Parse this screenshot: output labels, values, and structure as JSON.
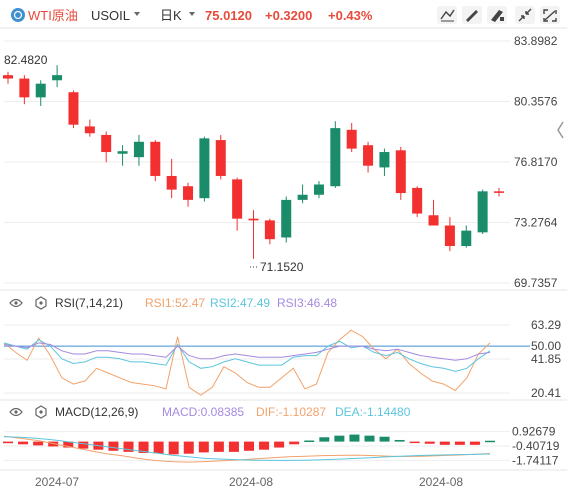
{
  "header": {
    "instrument_name": "WTI原油",
    "symbol": "USOIL",
    "period": "日K",
    "last_price": "75.0120",
    "change": "+0.3200",
    "change_pct": "+0.43%",
    "icons": [
      "instrument-logo-icon",
      "dropdown-caret-icon",
      "dropdown-caret-icon",
      "chart-style-icon",
      "draw-line-icon",
      "drawing-tools-icon",
      "shrink-icon",
      "fullscreen-icon"
    ]
  },
  "colors": {
    "up": "#f23030",
    "down": "#1a8c6a",
    "accent": "#e84a3b",
    "rsi1": "#f2a26b",
    "rsi2": "#5bc6de",
    "rsi3": "#a58ae0",
    "macd_label": "#a58ae0",
    "dif": "#f2a26b",
    "dea": "#5bc6de",
    "midline": "#3f8fd2",
    "grid": "#eeeeee",
    "text": "#333333",
    "axis_text": "#444444"
  },
  "price_axis_labels": [
    "83.8982",
    "80.3576",
    "76.8170",
    "73.2764",
    "69.7357"
  ],
  "rsi_axis_labels": [
    "63.29",
    "50.00",
    "41.85",
    "20.41"
  ],
  "macd_axis_labels": [
    "0.92679",
    "-0.40719",
    "-1.74117"
  ],
  "x_axis_labels": [
    "2024-07",
    "2024-08",
    "2024-08"
  ],
  "rsi_panel": {
    "name": "RSI(7,14,21)",
    "rsi1_label": "RSI1:52.47",
    "rsi2_label": "RSI2:47.49",
    "rsi3_label": "RSI3:46.48"
  },
  "macd_panel": {
    "name": "MACD(12,26,9)",
    "macd_label": "MACD:0.08385",
    "dif_label": "DIF:-1.10287",
    "dea_label": "DEA:-1.14480"
  },
  "chart_data": [
    {
      "type": "candlestick",
      "title": "WTI原油 USOIL 日K",
      "y_axis_ticks": [
        83.8982,
        80.3576,
        76.817,
        73.2764,
        69.7357
      ],
      "ylim": [
        69.7357,
        83.8982
      ],
      "x_tick_labels": [
        "2024-07",
        "2024-08",
        "2024-08"
      ],
      "annotations": [
        {
          "text": "82.4820",
          "value": 82.482,
          "kind": "highest visible high"
        },
        {
          "text": "71.1520",
          "value": 71.152,
          "kind": "lowest visible low"
        }
      ],
      "candles": [
        {
          "open": 81.9,
          "high": 82.1,
          "low": 81.4,
          "close": 81.7
        },
        {
          "open": 81.7,
          "high": 81.9,
          "low": 80.2,
          "close": 80.6
        },
        {
          "open": 80.6,
          "high": 81.6,
          "low": 80.1,
          "close": 81.4
        },
        {
          "open": 81.6,
          "high": 82.48,
          "low": 81.2,
          "close": 81.9
        },
        {
          "open": 80.9,
          "high": 81.0,
          "low": 78.8,
          "close": 79.0
        },
        {
          "open": 78.9,
          "high": 79.3,
          "low": 78.3,
          "close": 78.5
        },
        {
          "open": 78.4,
          "high": 78.6,
          "low": 76.8,
          "close": 77.4
        },
        {
          "open": 77.3,
          "high": 77.8,
          "low": 76.6,
          "close": 77.45
        },
        {
          "open": 77.1,
          "high": 78.4,
          "low": 76.6,
          "close": 78.0
        },
        {
          "open": 78.0,
          "high": 78.1,
          "low": 75.7,
          "close": 76.0
        },
        {
          "open": 76.0,
          "high": 77.0,
          "low": 74.7,
          "close": 75.2
        },
        {
          "open": 75.4,
          "high": 75.6,
          "low": 74.2,
          "close": 74.6
        },
        {
          "open": 74.7,
          "high": 78.3,
          "low": 74.5,
          "close": 78.2
        },
        {
          "open": 78.1,
          "high": 78.4,
          "low": 75.8,
          "close": 76.0
        },
        {
          "open": 75.8,
          "high": 75.9,
          "low": 72.8,
          "close": 73.5
        },
        {
          "open": 73.5,
          "high": 74.0,
          "low": 71.15,
          "close": 73.4
        },
        {
          "open": 73.4,
          "high": 73.5,
          "low": 72.0,
          "close": 72.3
        },
        {
          "open": 72.4,
          "high": 74.8,
          "low": 72.1,
          "close": 74.6
        },
        {
          "open": 74.6,
          "high": 75.5,
          "low": 74.4,
          "close": 74.9
        },
        {
          "open": 74.9,
          "high": 75.7,
          "low": 74.7,
          "close": 75.5
        },
        {
          "open": 75.4,
          "high": 79.2,
          "low": 75.3,
          "close": 78.8
        },
        {
          "open": 78.7,
          "high": 79.1,
          "low": 77.4,
          "close": 77.6
        },
        {
          "open": 77.8,
          "high": 78.0,
          "low": 76.2,
          "close": 76.6
        },
        {
          "open": 76.5,
          "high": 77.6,
          "low": 76.0,
          "close": 77.4
        },
        {
          "open": 77.5,
          "high": 77.7,
          "low": 74.6,
          "close": 75.0
        },
        {
          "open": 75.3,
          "high": 75.4,
          "low": 73.6,
          "close": 73.8
        },
        {
          "open": 73.7,
          "high": 74.6,
          "low": 73.1,
          "close": 73.1
        },
        {
          "open": 73.1,
          "high": 73.6,
          "low": 71.6,
          "close": 71.9
        },
        {
          "open": 71.9,
          "high": 73.1,
          "low": 71.8,
          "close": 72.8
        },
        {
          "open": 72.7,
          "high": 75.2,
          "low": 72.6,
          "close": 75.1
        },
        {
          "open": 75.1,
          "high": 75.3,
          "low": 74.8,
          "close": 75.01
        }
      ]
    },
    {
      "type": "line",
      "title": "RSI(7,14,21)",
      "y_axis_ticks": [
        63.29,
        50.0,
        41.85,
        20.41
      ],
      "ylim": [
        20.41,
        63.29
      ],
      "reference_line": 50.0,
      "series": [
        {
          "name": "RSI1",
          "values": [
            52,
            46,
            41,
            55,
            44,
            30,
            26,
            28,
            36,
            33,
            30,
            27,
            26,
            25,
            23,
            56,
            24,
            19,
            24,
            37,
            33,
            27,
            24,
            24,
            30,
            36,
            23,
            26,
            46,
            54,
            60,
            56,
            48,
            42,
            48,
            39,
            33,
            28,
            26,
            22,
            30,
            45,
            52
          ]
        },
        {
          "name": "RSI2",
          "values": [
            52,
            50,
            48,
            54,
            50,
            42,
            39,
            40,
            43,
            43,
            42,
            40,
            40,
            39,
            38,
            51,
            40,
            36,
            37,
            40,
            42,
            40,
            38,
            38,
            38,
            43,
            44,
            44,
            50,
            53,
            49,
            50,
            46,
            44,
            46,
            42,
            39,
            37,
            36,
            34,
            36,
            42,
            47
          ]
        },
        {
          "name": "RSI3",
          "values": [
            51,
            50,
            49,
            52,
            51,
            47,
            45,
            45,
            47,
            47,
            46,
            45,
            45,
            44,
            43,
            50,
            44,
            42,
            42,
            44,
            45,
            44,
            43,
            43,
            43,
            44,
            45,
            46,
            48,
            50,
            50,
            50,
            48,
            47,
            48,
            46,
            44,
            43,
            42,
            41,
            42,
            45,
            46
          ]
        }
      ]
    },
    {
      "type": "bar",
      "title": "MACD(12,26,9)",
      "y_axis_ticks": [
        0.92679,
        -0.40719,
        -1.74117
      ],
      "ylim": [
        -2.35,
        1.35
      ],
      "zero_line": 0,
      "histogram": [
        -0.15,
        -0.25,
        -0.35,
        -0.45,
        -0.55,
        -0.65,
        -0.75,
        -0.85,
        -0.95,
        -1.05,
        -1.1,
        -1.18,
        -1.12,
        -1.0,
        -0.95,
        -0.95,
        -0.85,
        -0.75,
        -0.55,
        -0.25,
        0.1,
        0.4,
        0.55,
        0.65,
        0.55,
        0.45,
        0.15,
        -0.1,
        -0.2,
        -0.3,
        -0.3,
        -0.3,
        0.08
      ],
      "series": [
        {
          "name": "DIF",
          "values": [
            0.5,
            0.3,
            0.1,
            -0.2,
            -0.5,
            -0.8,
            -1.1,
            -1.3,
            -1.55,
            -1.75,
            -1.85,
            -1.9,
            -1.85,
            -1.78,
            -1.7,
            -1.6,
            -1.5,
            -1.4,
            -1.35,
            -1.3,
            -1.28,
            -1.25,
            -1.3,
            -1.35,
            -1.38,
            -1.35,
            -1.3,
            -1.25,
            -1.18,
            -1.1
          ]
        },
        {
          "name": "DEA",
          "values": [
            0.45,
            0.4,
            0.3,
            0.15,
            -0.05,
            -0.25,
            -0.45,
            -0.65,
            -0.85,
            -1.05,
            -1.25,
            -1.4,
            -1.55,
            -1.62,
            -1.68,
            -1.72,
            -1.74,
            -1.74,
            -1.72,
            -1.68,
            -1.62,
            -1.55,
            -1.48,
            -1.4,
            -1.33,
            -1.28,
            -1.24,
            -1.2,
            -1.18,
            -1.15
          ]
        }
      ]
    }
  ]
}
